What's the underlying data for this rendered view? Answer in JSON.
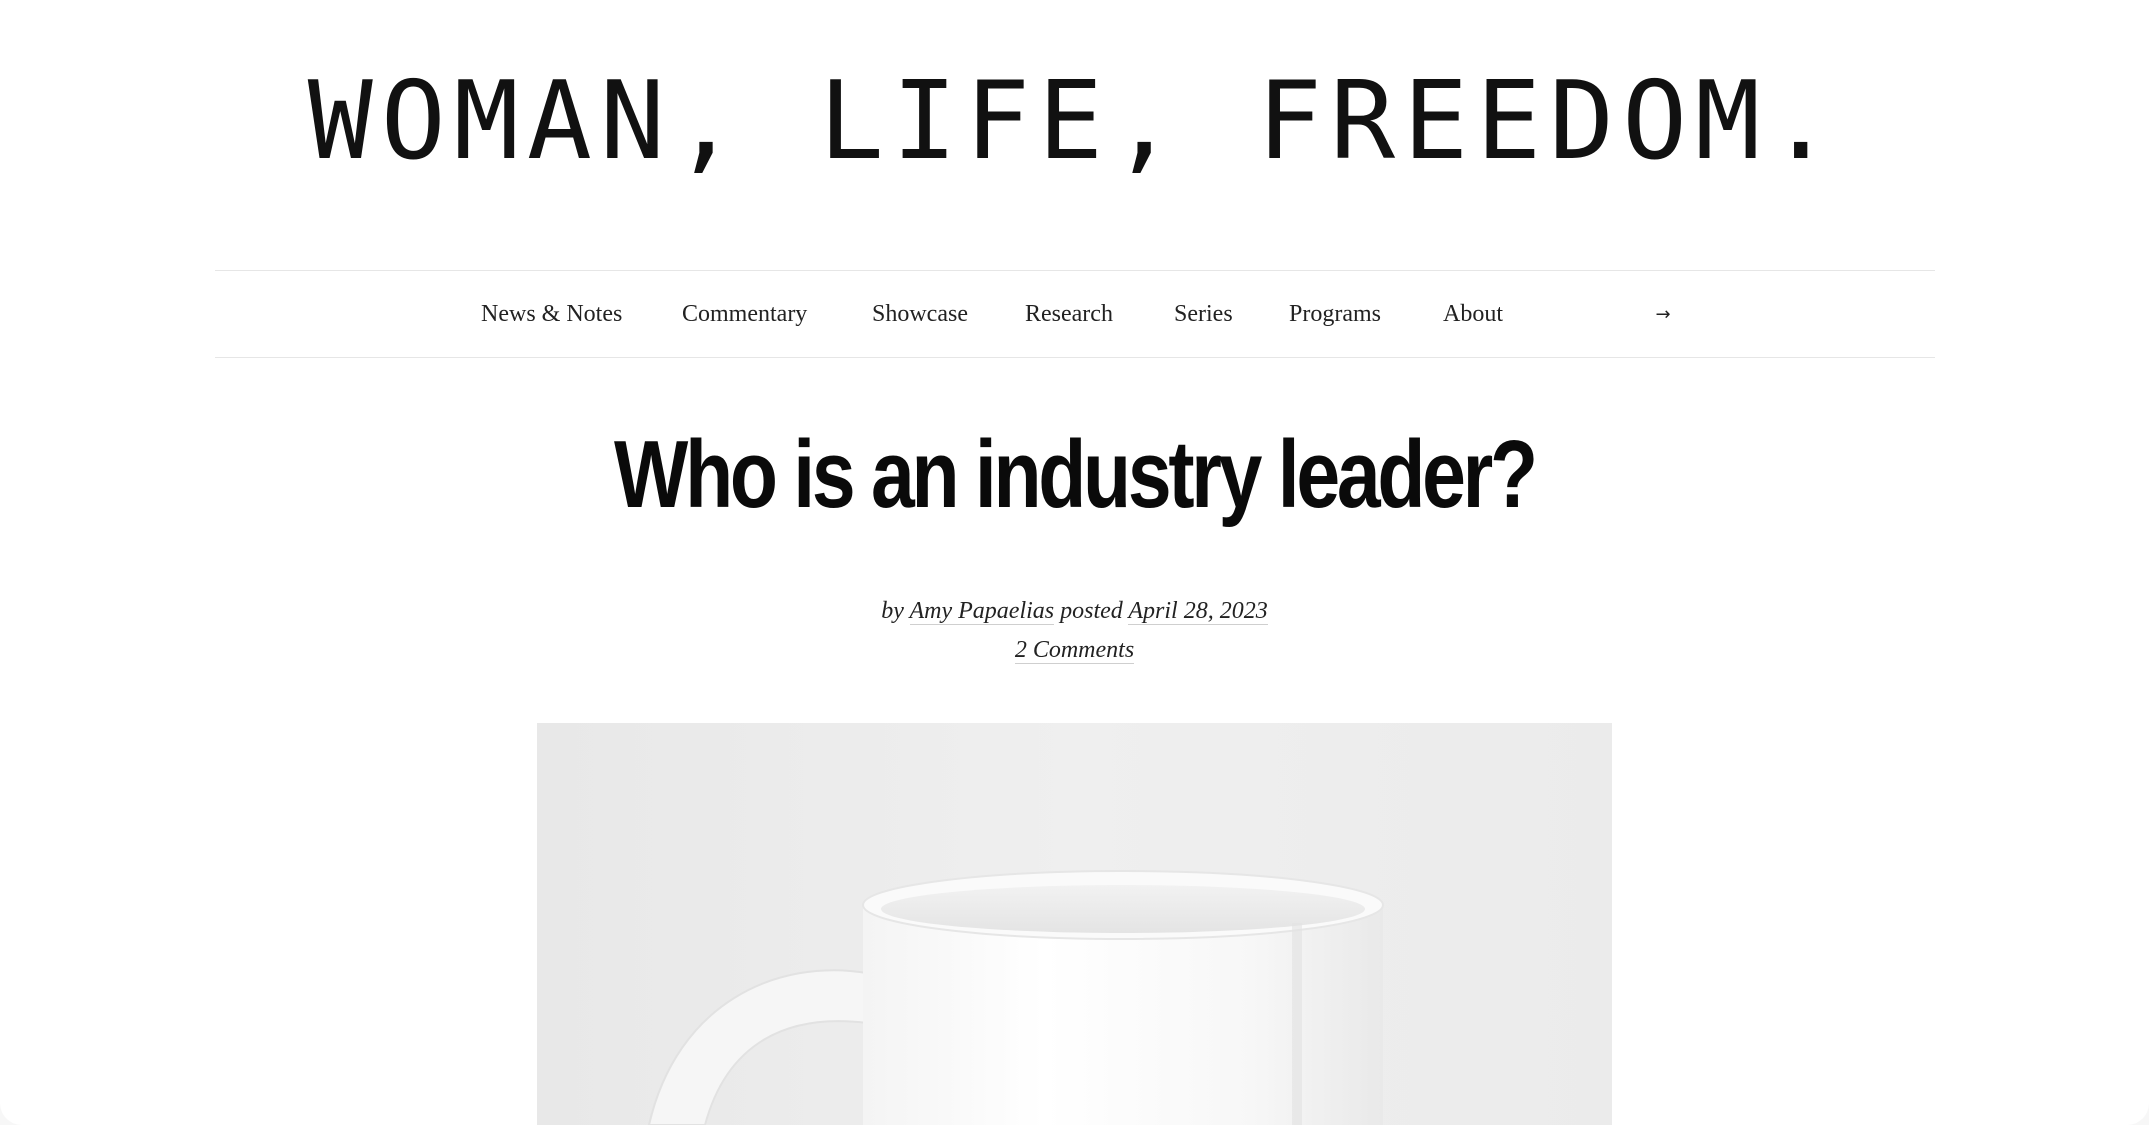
{
  "site": {
    "title": "WOMAN, LIFE, FREEDOM."
  },
  "nav": {
    "items": [
      {
        "label": "News & Notes"
      },
      {
        "label": "Commentary"
      },
      {
        "label": "Showcase"
      },
      {
        "label": "Research"
      },
      {
        "label": "Series"
      },
      {
        "label": "Programs"
      },
      {
        "label": "About"
      }
    ],
    "arrow_glyph": "→",
    "arrow_icon": "arrow-right-icon"
  },
  "post": {
    "title": "Who is an industry leader?",
    "by_prefix": "by",
    "author": "Amy Papaelias",
    "posted_label": "posted",
    "date": "April 28, 2023",
    "comments": "2 Comments",
    "image_subject": "white mug"
  }
}
